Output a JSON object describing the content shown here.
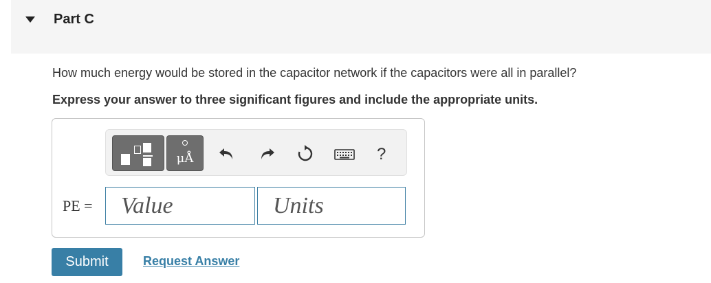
{
  "part": {
    "title": "Part C"
  },
  "question": {
    "text": "How much energy would be stored in the capacitor network if the capacitors were all in parallel?",
    "instruction": "Express your answer to three significant figures and include the appropriate units."
  },
  "toolbar": {
    "templates_icon": "fraction-templates-icon",
    "units_icon": "units-icon",
    "units_glyph": "μÅ",
    "undo_icon": "undo-icon",
    "redo_icon": "redo-icon",
    "reset_icon": "reset-icon",
    "keyboard_icon": "keyboard-icon",
    "help_label": "?"
  },
  "answer": {
    "label": "PE =",
    "value_placeholder": "Value",
    "units_placeholder": "Units"
  },
  "actions": {
    "submit_label": "Submit",
    "request_answer_label": "Request Answer"
  },
  "colors": {
    "accent": "#387fa6",
    "header_bg": "#f5f5f5",
    "toolbar_button": "#6e6e6e"
  }
}
